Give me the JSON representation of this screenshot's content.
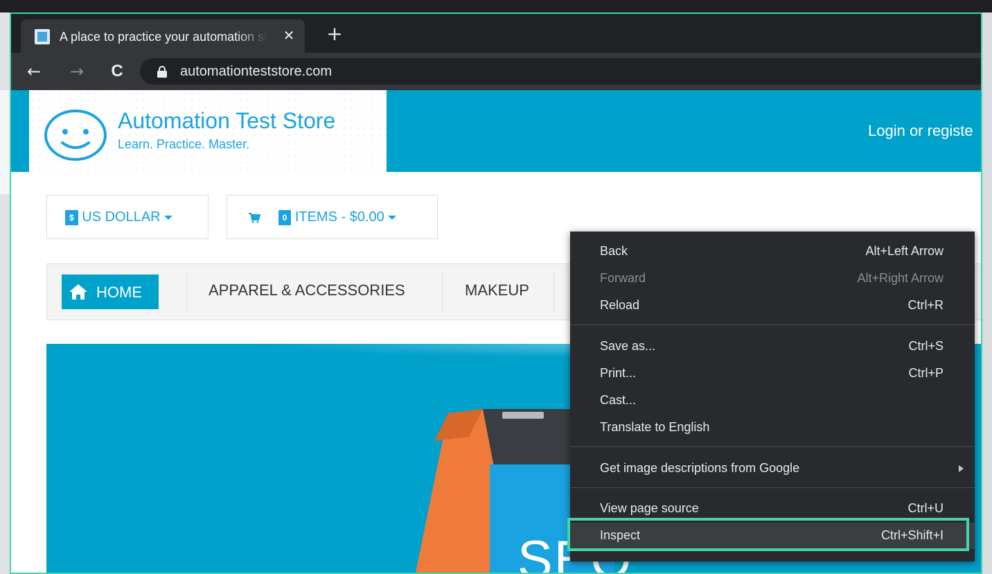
{
  "browser": {
    "tab_title": "A place to practice your automation skills",
    "tab_close": "✕",
    "new_tab": "+",
    "url": "automationteststore.com",
    "nav": {
      "back": "←",
      "forward": "→",
      "reload": "C"
    }
  },
  "site": {
    "logo_title": "Automation Test Store",
    "logo_tagline": "Learn. Practice. Master.",
    "login_link": "Login or registe",
    "currency": {
      "badge": "$",
      "label": "US DOLLAR"
    },
    "cart": {
      "count": "0",
      "label": "ITEMS - $0.00"
    },
    "nav": {
      "home": "HOME",
      "items": [
        "APPAREL & ACCESSORIES",
        "MAKEUP"
      ]
    },
    "banner_text": "SEO"
  },
  "context_menu": {
    "items": [
      {
        "label": "Back",
        "shortcut": "Alt+Left Arrow",
        "disabled": false
      },
      {
        "label": "Forward",
        "shortcut": "Alt+Right Arrow",
        "disabled": true
      },
      {
        "label": "Reload",
        "shortcut": "Ctrl+R",
        "disabled": false
      },
      {
        "label": "Save as...",
        "shortcut": "Ctrl+S",
        "disabled": false
      },
      {
        "label": "Print...",
        "shortcut": "Ctrl+P",
        "disabled": false
      },
      {
        "label": "Cast...",
        "shortcut": "",
        "disabled": false
      },
      {
        "label": "Translate to English",
        "shortcut": "",
        "disabled": false
      },
      {
        "label": "Get image descriptions from Google",
        "shortcut": "",
        "disabled": false
      },
      {
        "label": "View page source",
        "shortcut": "Ctrl+U",
        "disabled": false
      },
      {
        "label": "Inspect",
        "shortcut": "Ctrl+Shift+I",
        "disabled": false
      }
    ]
  },
  "colors": {
    "brand_blue": "#00a1cb",
    "highlight": "#3ed7a8",
    "menu_bg": "#292a2d"
  }
}
